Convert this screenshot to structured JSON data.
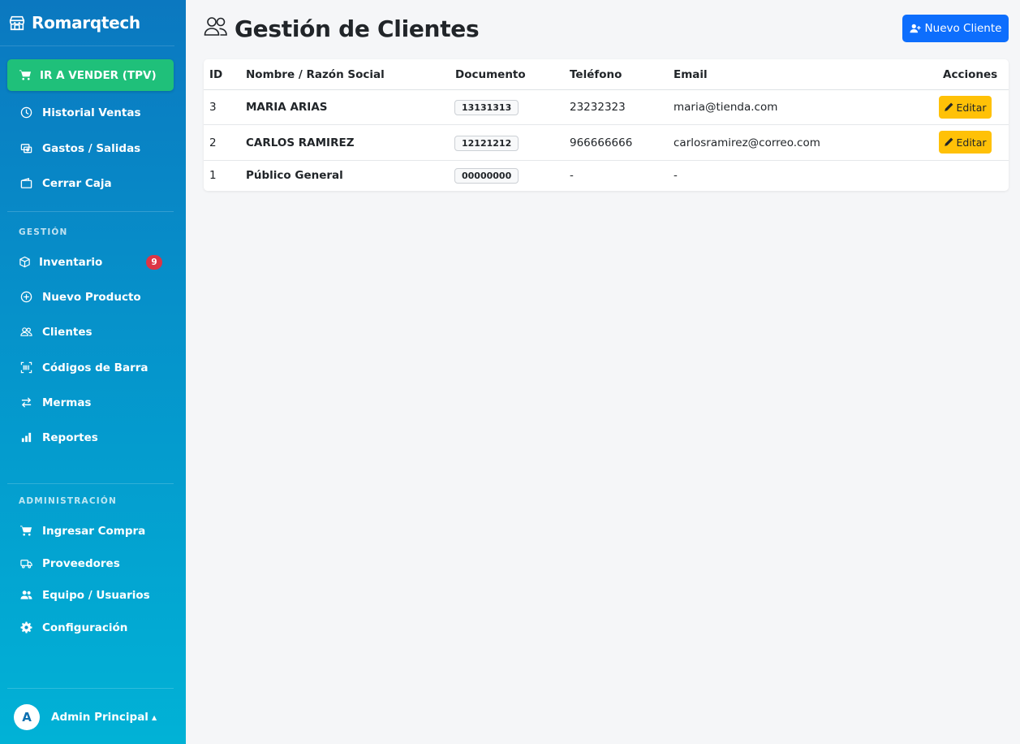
{
  "brand": {
    "name": "Romarqtech",
    "icon": "shop-icon"
  },
  "sidebar": {
    "tpv_label": "IR A VENDER (TPV)",
    "main_items": [
      {
        "label": "Historial Ventas",
        "icon": "clock-icon"
      },
      {
        "label": "Gastos / Salidas",
        "icon": "cash-icon"
      },
      {
        "label": "Cerrar Caja",
        "icon": "wallet-icon"
      }
    ],
    "gestion_title": "GESTIÓN",
    "gestion_items": [
      {
        "label": "Inventario",
        "icon": "box-icon",
        "badge": "9"
      },
      {
        "label": "Nuevo Producto",
        "icon": "plus-circle-icon"
      },
      {
        "label": "Clientes",
        "icon": "people-icon"
      },
      {
        "label": "Códigos de Barra",
        "icon": "barcode-icon"
      },
      {
        "label": "Mermas",
        "icon": "arrows-icon"
      },
      {
        "label": "Reportes",
        "icon": "bar-chart-icon"
      }
    ],
    "admin_title": "ADMINISTRACIÓN",
    "admin_items": [
      {
        "label": "Ingresar Compra",
        "icon": "cart-icon"
      },
      {
        "label": "Proveedores",
        "icon": "truck-icon"
      },
      {
        "label": "Equipo / Usuarios",
        "icon": "users-icon"
      },
      {
        "label": "Configuración",
        "icon": "gear-icon"
      }
    ],
    "user": {
      "initial": "A",
      "name": "Admin Principal"
    }
  },
  "main": {
    "title": "Gestión de Clientes",
    "new_button": "Nuevo Cliente",
    "table": {
      "headers": [
        "ID",
        "Nombre / Razón Social",
        "Documento",
        "Teléfono",
        "Email",
        "Acciones"
      ],
      "rows": [
        {
          "id": "3",
          "name": "MARIA ARIAS",
          "doc": "13131313",
          "phone": "23232323",
          "email": "maria@tienda.com",
          "action": "Editar"
        },
        {
          "id": "2",
          "name": "CARLOS RAMIREZ",
          "doc": "12121212",
          "phone": "966666666",
          "email": "carlosramirez@correo.com",
          "action": "Editar"
        },
        {
          "id": "1",
          "name": "Público General",
          "doc": "00000000",
          "phone": "-",
          "email": "-",
          "action": ""
        }
      ]
    }
  },
  "colors": {
    "sidebar_top": "#0b78c0",
    "sidebar_bottom": "#01b2d6",
    "tpv": "#1fc07a",
    "primary": "#0d6efd",
    "warning": "#ffc107",
    "badge": "#dc3545"
  }
}
